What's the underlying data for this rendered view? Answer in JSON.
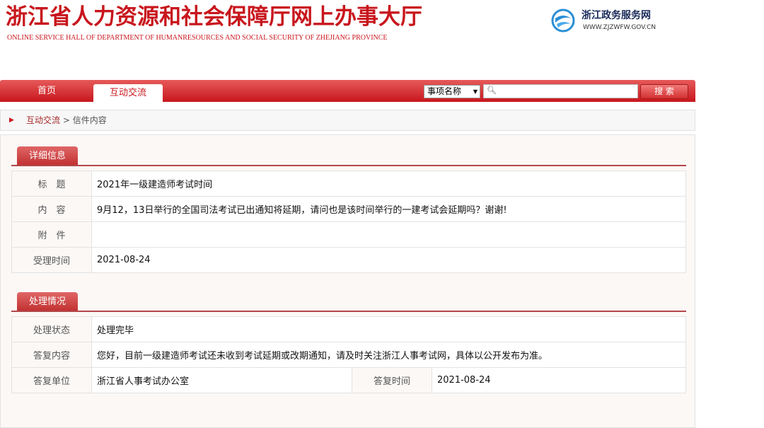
{
  "header": {
    "title": "浙江省人力资源和社会保障厅网上办事大厅",
    "subtitle": "ONLINE SERVICE HALL OF DEPARTMENT OF HUMANRESOURCES AND SOCIAL SECURITY OF ZHEJIANG PROVINCE",
    "gov_name": "浙江政务服务网",
    "gov_url": "WWW.ZJZWFW.GOV.CN"
  },
  "nav": {
    "home": "首页",
    "active_tab": "互动交流",
    "search_select": "事项名称",
    "search_placeholder": "",
    "search_button": "搜 索"
  },
  "breadcrumb": {
    "link": "互动交流",
    "separator": ">",
    "current": "信件内容"
  },
  "detail": {
    "heading": "详细信息",
    "rows": [
      {
        "label": "标　题",
        "value": "2021年一级建造师考试时间"
      },
      {
        "label": "内　容",
        "value": "9月12，13日举行的全国司法考试已出通知将延期，请问也是该时间举行的一建考试会延期吗？谢谢!"
      },
      {
        "label": "附　件",
        "value": ""
      },
      {
        "label": "受理时间",
        "value": "2021-08-24"
      }
    ]
  },
  "handling": {
    "heading": "处理情况",
    "status_label": "处理状态",
    "status_value": "处理完毕",
    "reply_label": "答复内容",
    "reply_value": "您好，目前一级建造师考试还未收到考试延期或改期通知，请及时关注浙江人事考试网，具体以公开发布为准。",
    "unit_label": "答复单位",
    "unit_value": "浙江省人事考试办公室",
    "time_label": "答复时间",
    "time_value": "2021-08-24"
  },
  "colors": {
    "brand_red": "#c8161d",
    "section_red": "#c23232"
  }
}
